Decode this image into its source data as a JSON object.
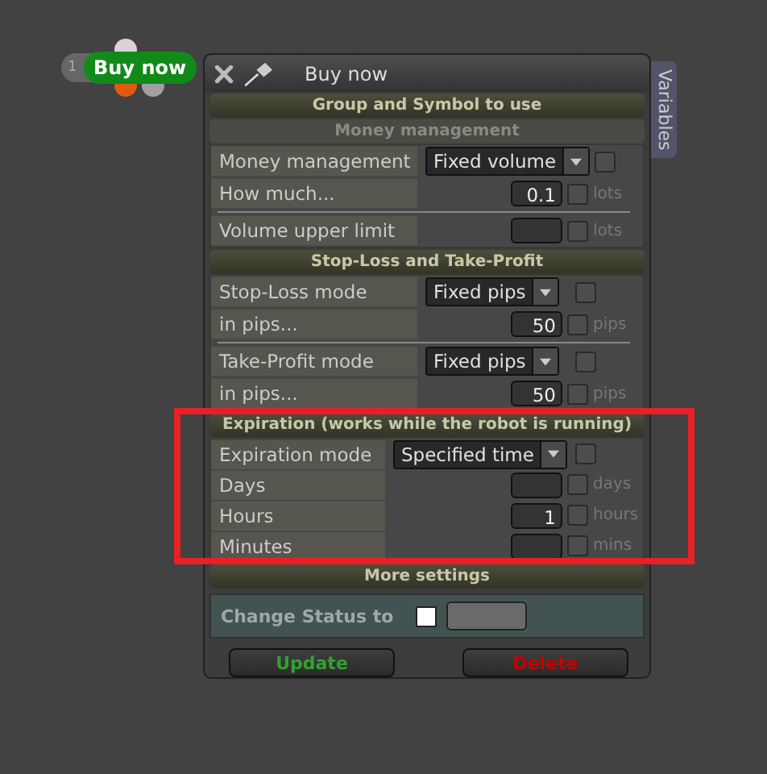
{
  "node": {
    "count": "1",
    "label": "Buy now"
  },
  "window": {
    "title": "Buy now",
    "side_tab": "Variables"
  },
  "sections": [
    {
      "title": "Group and Symbol to use",
      "kind": "main"
    },
    {
      "title": "Money management",
      "kind": "sub",
      "rows": [
        {
          "kind": "select",
          "label": "Money management",
          "value": "Fixed volume",
          "checked": false
        },
        {
          "kind": "number",
          "label": "How much...",
          "value": "0.1",
          "unit": "lots",
          "checked": false
        },
        {
          "kind": "divider"
        },
        {
          "kind": "number",
          "label": "Volume upper limit",
          "unit": "lots",
          "checked": false
        }
      ]
    },
    {
      "title": "Stop-Loss and Take-Profit",
      "kind": "main",
      "rows": [
        {
          "kind": "select",
          "label": "Stop-Loss mode",
          "value": "Fixed pips",
          "checked": false
        },
        {
          "kind": "number",
          "label": "in pips...",
          "value": "50",
          "unit": "pips",
          "checked": false
        },
        {
          "kind": "divider"
        },
        {
          "kind": "select",
          "label": "Take-Profit mode",
          "value": "Fixed pips",
          "checked": false
        },
        {
          "kind": "number",
          "label": "in pips...",
          "value": "50",
          "unit": "pips",
          "checked": false
        }
      ]
    },
    {
      "title": "Expiration (works while the robot is running)",
      "kind": "main",
      "rows": [
        {
          "kind": "select",
          "label": "Expiration mode",
          "value": "Specified time",
          "checked": false
        },
        {
          "kind": "number",
          "label": "Days",
          "unit": "days",
          "checked": false
        },
        {
          "kind": "number",
          "label": "Hours",
          "value": "1",
          "unit": "hours",
          "checked": false
        },
        {
          "kind": "number",
          "label": "Minutes",
          "unit": "mins",
          "checked": false
        }
      ]
    },
    {
      "title": "More settings",
      "kind": "main"
    }
  ],
  "status": {
    "label": "Change Status to",
    "checked": false
  },
  "buttons": [
    {
      "label": "Update",
      "kind": "update"
    },
    {
      "label": "Delete",
      "kind": "delete"
    }
  ]
}
